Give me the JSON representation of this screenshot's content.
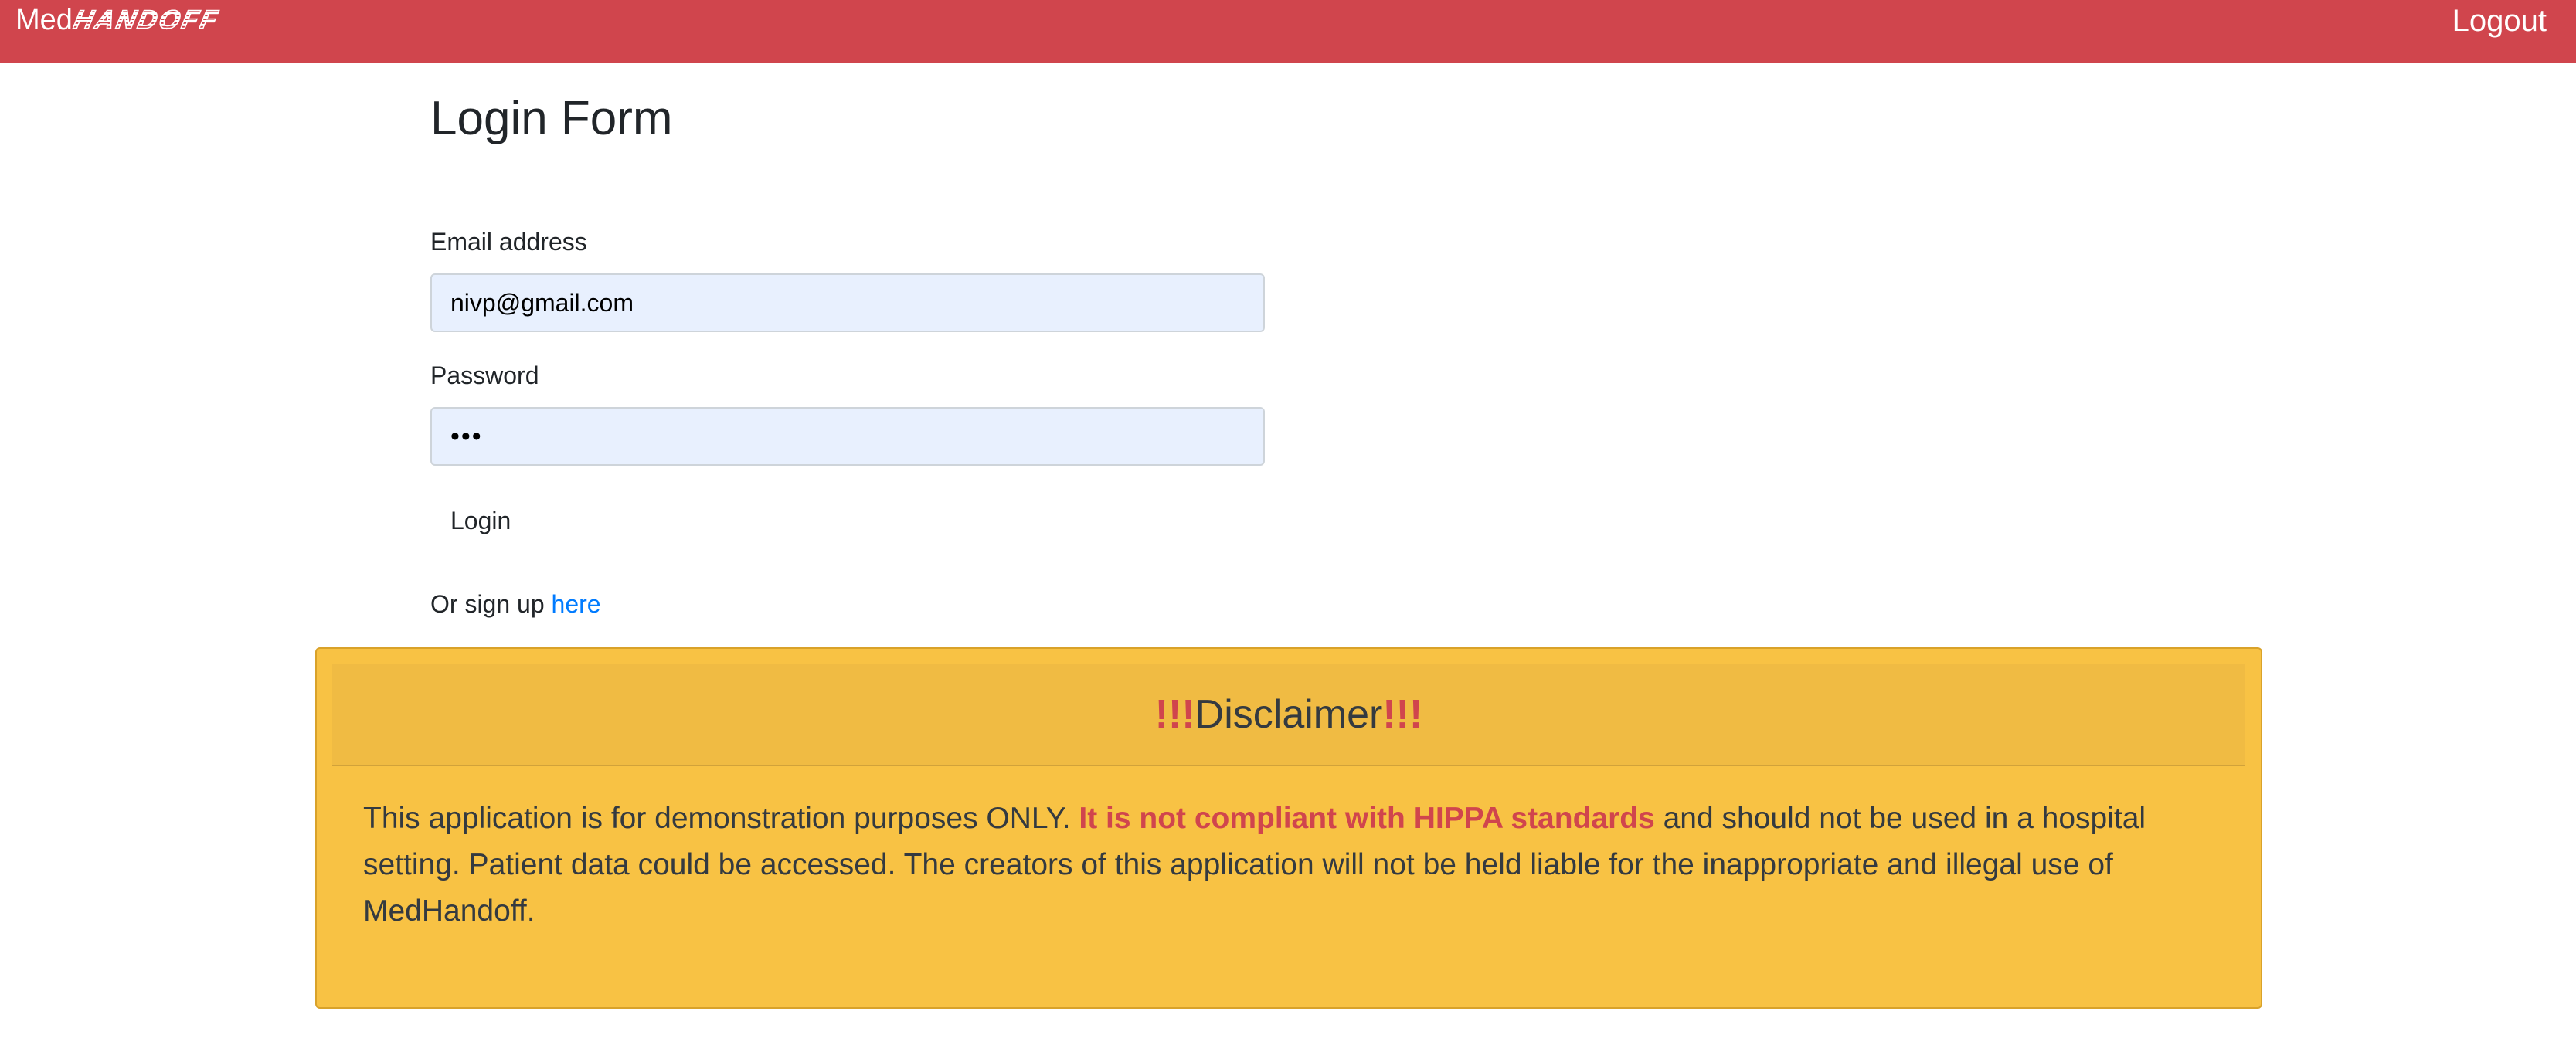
{
  "navbar": {
    "brand_prefix": "Med",
    "brand_logo": "HANDOFF",
    "logout_label": "Logout",
    "background_color": "#d0454d"
  },
  "form": {
    "title": "Login Form",
    "email_label": "Email address",
    "email_value": "nivp@gmail.com",
    "password_label": "Password",
    "password_display": "•••",
    "login_label": "Login",
    "signup_text": "Or sign up ",
    "signup_link": "here"
  },
  "disclaimer": {
    "bang_left": "!!!",
    "title": "Disclaimer",
    "bang_right": "!!!",
    "body_start": "This application is for demonstration purposes ONLY. ",
    "body_highlight": "It is not compliant with HIPPA standards",
    "body_end": " and should not be used in a hospital setting. Patient data could be accessed. The creators of this application will not be held liable for the inappropriate and illegal use of MedHandoff.",
    "background_color": "#f8c244",
    "highlight_color": "#d0454d"
  }
}
